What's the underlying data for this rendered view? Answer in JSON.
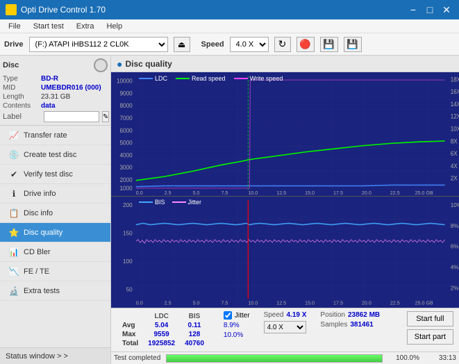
{
  "app": {
    "title": "Opti Drive Control 1.70",
    "icon": "disc-icon"
  },
  "titlebar": {
    "minimize_label": "−",
    "maximize_label": "□",
    "close_label": "✕"
  },
  "menubar": {
    "items": [
      "File",
      "Start test",
      "Extra",
      "Help"
    ]
  },
  "toolbar": {
    "drive_label": "Drive",
    "drive_value": "(F:)  ATAPI iHBS112  2 CL0K",
    "speed_label": "Speed",
    "speed_value": "4.0 X"
  },
  "disc": {
    "title": "Disc",
    "type_label": "Type",
    "type_value": "BD-R",
    "mid_label": "MID",
    "mid_value": "UMEBDR016 (000)",
    "length_label": "Length",
    "length_value": "23.31 GB",
    "contents_label": "Contents",
    "contents_value": "data",
    "label_label": "Label",
    "label_value": ""
  },
  "nav": {
    "items": [
      {
        "id": "transfer-rate",
        "label": "Transfer rate",
        "icon": "📈"
      },
      {
        "id": "create-test-disc",
        "label": "Create test disc",
        "icon": "💿"
      },
      {
        "id": "verify-test-disc",
        "label": "Verify test disc",
        "icon": "✔"
      },
      {
        "id": "drive-info",
        "label": "Drive info",
        "icon": "ℹ"
      },
      {
        "id": "disc-info",
        "label": "Disc info",
        "icon": "📋"
      },
      {
        "id": "disc-quality",
        "label": "Disc quality",
        "icon": "⭐",
        "active": true
      },
      {
        "id": "cd-bler",
        "label": "CD Bler",
        "icon": "📊"
      },
      {
        "id": "fe-te",
        "label": "FE / TE",
        "icon": "📉"
      },
      {
        "id": "extra-tests",
        "label": "Extra tests",
        "icon": "🔬"
      }
    ]
  },
  "status_window": {
    "label": "Status window > >"
  },
  "chart": {
    "title": "Disc quality",
    "legend": {
      "ldc": "LDC",
      "read_speed": "Read speed",
      "write_speed": "Write speed"
    },
    "top": {
      "y_left_max": 10000,
      "y_right_labels": [
        "18X",
        "16X",
        "14X",
        "12X",
        "10X",
        "8X",
        "6X",
        "4X",
        "2X"
      ],
      "x_labels": [
        "0.0",
        "2.5",
        "5.0",
        "7.5",
        "10.0",
        "12.5",
        "15.0",
        "17.5",
        "20.0",
        "22.5",
        "25.0 GB"
      ],
      "y_left_labels": [
        "10000",
        "9000",
        "8000",
        "7000",
        "6000",
        "5000",
        "4000",
        "3000",
        "2000",
        "1000"
      ]
    },
    "bottom": {
      "legend": {
        "bis": "BIS",
        "jitter": "Jitter"
      },
      "y_left_labels": [
        "200",
        "150",
        "100",
        "50"
      ],
      "y_right_labels": [
        "10%",
        "8%",
        "6%",
        "4%",
        "2%"
      ],
      "x_labels": [
        "0.0",
        "2.5",
        "5.0",
        "7.5",
        "10.0",
        "12.5",
        "15.0",
        "17.5",
        "20.0",
        "22.5",
        "25.0 GB"
      ]
    }
  },
  "stats": {
    "columns": [
      "LDC",
      "BIS"
    ],
    "rows": [
      {
        "label": "Avg",
        "ldc": "5.04",
        "bis": "0.11"
      },
      {
        "label": "Max",
        "ldc": "9559",
        "bis": "128"
      },
      {
        "label": "Total",
        "ldc": "1925852",
        "bis": "40760"
      }
    ],
    "jitter": {
      "label": "Jitter",
      "avg": "8.9%",
      "max": "10.0%"
    },
    "speed": {
      "label": "Speed",
      "value": "4.19 X"
    },
    "speed_select": "4.0 X",
    "position": {
      "label": "Position",
      "value": "23862 MB"
    },
    "samples": {
      "label": "Samples",
      "value": "381461"
    },
    "buttons": {
      "start_full": "Start full",
      "start_part": "Start part"
    }
  },
  "progress": {
    "percent": 100,
    "status": "Test completed",
    "time": "33:13"
  }
}
